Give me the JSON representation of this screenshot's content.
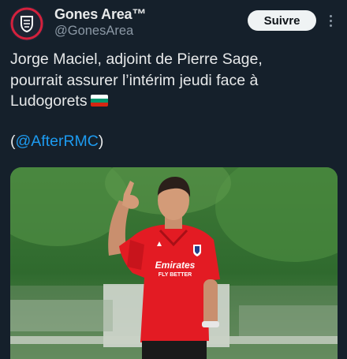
{
  "account": {
    "display_name": "Gones Area™",
    "handle": "@GonesArea",
    "avatar_icon": "club-crest-icon"
  },
  "actions": {
    "follow_label": "Suivre",
    "more_icon": "more-vertical-icon"
  },
  "tweet": {
    "lines": [
      "Jorge Maciel, adjoint de Pierre Sage,",
      "pourrait assurer l’intérim jeudi face à",
      "Ludogorets"
    ],
    "flag": "Bulgaria",
    "mention_open": "(",
    "mention": "@AfterRMC",
    "mention_close": ")"
  },
  "photo_jersey": {
    "sponsor_line1": "Emirates",
    "sponsor_line2": "FLY BETTER"
  },
  "colors": {
    "background": "#15202b",
    "text": "#e7e9ea",
    "secondary": "#8b98a5",
    "link": "#1d9bf0",
    "jersey": "#e31b23"
  }
}
